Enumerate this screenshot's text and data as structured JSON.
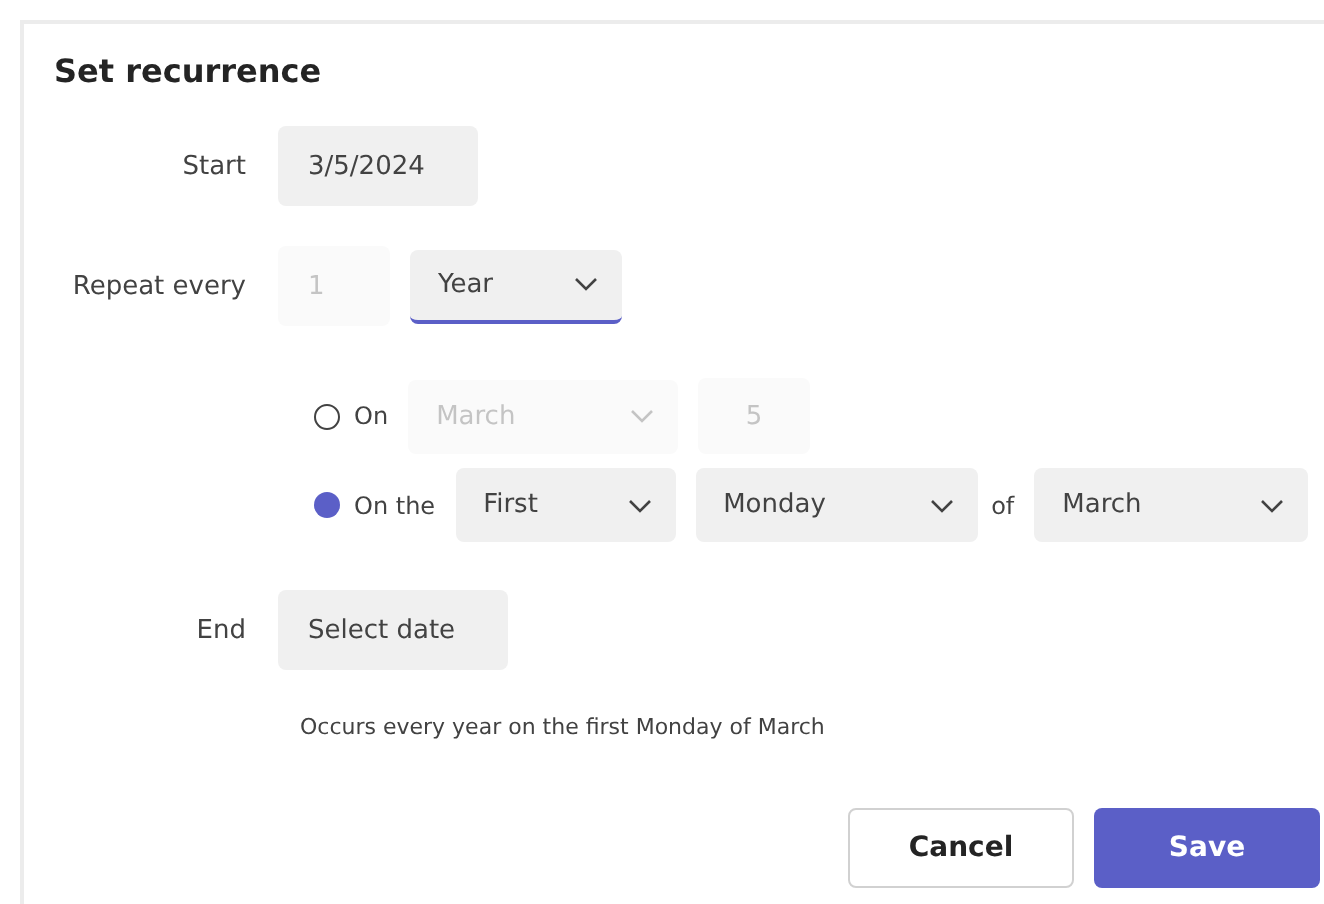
{
  "title": "Set recurrence",
  "start": {
    "label": "Start",
    "value": "3/5/2024"
  },
  "repeat": {
    "label": "Repeat every",
    "interval": {
      "value": "1",
      "disabled": true
    },
    "unit": {
      "value": "Year",
      "focused": true
    }
  },
  "options": [
    {
      "kind": "on",
      "label": "On",
      "selected": false,
      "month": {
        "value": "March",
        "disabled": true
      },
      "day": {
        "value": "5",
        "disabled": true
      }
    },
    {
      "kind": "on_the",
      "label": "On the",
      "selected": true,
      "ordinal": {
        "value": "First"
      },
      "weekday": {
        "value": "Monday"
      },
      "of_label": "of",
      "month": {
        "value": "March"
      }
    }
  ],
  "end": {
    "label": "End",
    "placeholder": "Select date"
  },
  "summary": "Occurs every year on the first Monday of March",
  "buttons": [
    {
      "label": "Cancel",
      "kind": "secondary"
    },
    {
      "label": "Save",
      "kind": "primary"
    }
  ]
}
